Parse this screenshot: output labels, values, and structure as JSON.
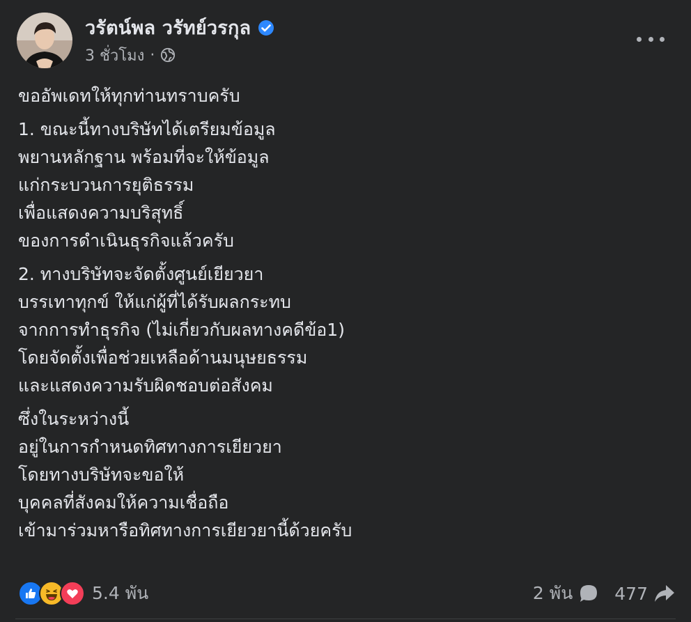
{
  "post": {
    "author": "วรัตน์พล วรัทย์วรกุล",
    "time": "3 ชั่วโมง",
    "separator": "·",
    "paragraphs": [
      [
        "ขออัพเดทให้ทุกท่านทราบครับ"
      ],
      [
        "1. ขณะนี้ทางบริษัทได้เตรียมข้อมูล",
        "พยานหลักฐาน พร้อมที่จะให้ข้อมูล",
        "แก่กระบวนการยุติธรรม",
        "เพื่อแสดงความบริสุทธิ์",
        "ของการดำเนินธุรกิจแล้วครับ"
      ],
      [
        "2. ทางบริษัทจะจัดตั้งศูนย์เยียวยา",
        "บรรเทาทุกข์ ให้แก่ผู้ที่ได้รับผลกระทบ",
        "จากการทำธุรกิจ (ไม่เกี่ยวกับผลทางคดีข้อ1)",
        "โดยจัดตั้งเพื่อช่วยเหลือด้านมนุษยธรรม",
        "และแสดงความรับผิดชอบต่อสังคม"
      ],
      [
        "ซึ่งในระหว่างนี้",
        "อยู่ในการกำหนดทิศทางการเยียวยา",
        "โดยทางบริษัทจะขอให้",
        "บุคคลที่สังคมให้ความเชื่อถือ",
        "เข้ามาร่วมหารือทิศทางการเยียวยานี้ด้วยครับ"
      ]
    ],
    "reactions": {
      "icons": [
        "like-icon",
        "haha-icon",
        "love-icon"
      ],
      "count": "5.4 พัน"
    },
    "comments": "2 พัน",
    "shares": "477"
  },
  "colors": {
    "background": "#242526",
    "text": "#e4e6eb",
    "secondary": "#b0b3b8",
    "verified": "#2d88ff",
    "like": "#1877f2",
    "love": "#f33e58",
    "haha": "#f7b928"
  }
}
